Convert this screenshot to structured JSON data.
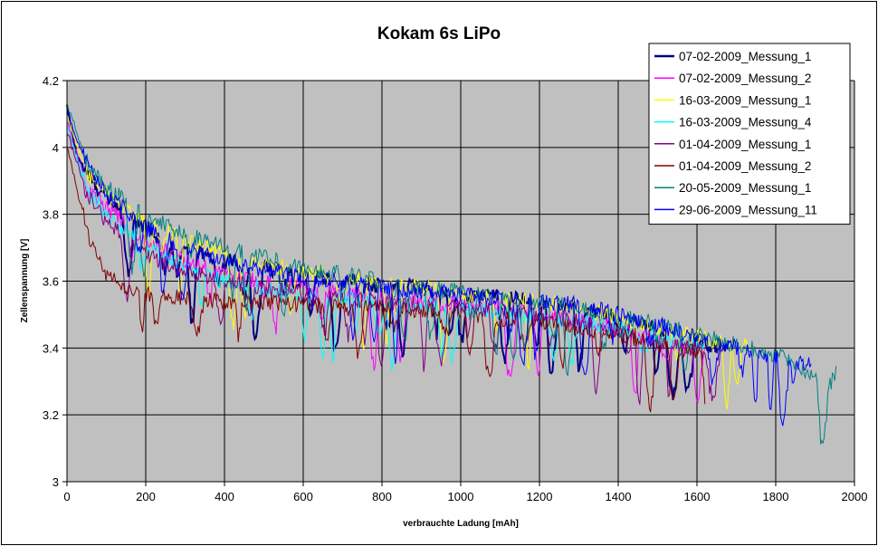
{
  "chart_data": {
    "type": "line",
    "title": "Kokam 6s LiPo",
    "xlabel": "verbrauchte Ladung [mAh]",
    "ylabel": "Zellenspannung [V]",
    "xlim": [
      0,
      2000
    ],
    "ylim": [
      3,
      4.2
    ],
    "x_ticks": [
      "0",
      "200",
      "400",
      "600",
      "800",
      "1000",
      "1200",
      "1400",
      "1600",
      "1800",
      "2000"
    ],
    "y_ticks": [
      "3",
      "3.2",
      "3.4",
      "3.6",
      "3.8",
      "4",
      "4.2"
    ],
    "grid": true,
    "plot_background": "#c0c0c0",
    "legend_position": "top-right",
    "series": [
      {
        "name": "07-02-2009_Messung_1",
        "color": "#000080",
        "end_x": 1680,
        "points": [
          [
            0,
            4.12
          ],
          [
            25,
            3.98
          ],
          [
            50,
            3.92
          ],
          [
            100,
            3.85
          ],
          [
            150,
            3.8
          ],
          [
            200,
            3.76
          ],
          [
            250,
            3.72
          ],
          [
            300,
            3.69
          ],
          [
            400,
            3.66
          ],
          [
            500,
            3.64
          ],
          [
            600,
            3.62
          ],
          [
            700,
            3.6
          ],
          [
            800,
            3.59
          ],
          [
            900,
            3.58
          ],
          [
            1000,
            3.56
          ],
          [
            1100,
            3.55
          ],
          [
            1200,
            3.54
          ],
          [
            1300,
            3.52
          ],
          [
            1400,
            3.49
          ],
          [
            1500,
            3.45
          ],
          [
            1600,
            3.42
          ],
          [
            1680,
            3.4
          ]
        ]
      },
      {
        "name": "07-02-2009_Messung_2",
        "color": "#ff00ff",
        "end_x": 1620,
        "points": [
          [
            0,
            4.08
          ],
          [
            50,
            3.88
          ],
          [
            100,
            3.82
          ],
          [
            200,
            3.72
          ],
          [
            300,
            3.66
          ],
          [
            400,
            3.62
          ],
          [
            500,
            3.6
          ],
          [
            600,
            3.58
          ],
          [
            700,
            3.56
          ],
          [
            800,
            3.55
          ],
          [
            900,
            3.54
          ],
          [
            1000,
            3.53
          ],
          [
            1100,
            3.52
          ],
          [
            1200,
            3.5
          ],
          [
            1300,
            3.48
          ],
          [
            1400,
            3.46
          ],
          [
            1500,
            3.42
          ],
          [
            1620,
            3.38
          ]
        ]
      },
      {
        "name": "16-03-2009_Messung_1",
        "color": "#ffff00",
        "end_x": 1730,
        "points": [
          [
            0,
            4.1
          ],
          [
            50,
            3.92
          ],
          [
            100,
            3.86
          ],
          [
            200,
            3.78
          ],
          [
            300,
            3.72
          ],
          [
            400,
            3.68
          ],
          [
            500,
            3.65
          ],
          [
            600,
            3.63
          ],
          [
            700,
            3.61
          ],
          [
            800,
            3.59
          ],
          [
            900,
            3.58
          ],
          [
            1000,
            3.56
          ],
          [
            1100,
            3.55
          ],
          [
            1200,
            3.54
          ],
          [
            1300,
            3.52
          ],
          [
            1400,
            3.49
          ],
          [
            1500,
            3.46
          ],
          [
            1600,
            3.43
          ],
          [
            1730,
            3.41
          ]
        ]
      },
      {
        "name": "16-03-2009_Messung_4",
        "color": "#00ffff",
        "end_x": 1620,
        "points": [
          [
            0,
            4.06
          ],
          [
            50,
            3.88
          ],
          [
            100,
            3.8
          ],
          [
            200,
            3.7
          ],
          [
            300,
            3.64
          ],
          [
            400,
            3.6
          ],
          [
            500,
            3.58
          ],
          [
            600,
            3.56
          ],
          [
            700,
            3.55
          ],
          [
            800,
            3.54
          ],
          [
            900,
            3.53
          ],
          [
            1000,
            3.52
          ],
          [
            1100,
            3.51
          ],
          [
            1200,
            3.49
          ],
          [
            1300,
            3.48
          ],
          [
            1400,
            3.46
          ],
          [
            1500,
            3.43
          ],
          [
            1620,
            3.4
          ]
        ]
      },
      {
        "name": "01-04-2009_Messung_1",
        "color": "#800080",
        "end_x": 1660,
        "points": [
          [
            0,
            4.05
          ],
          [
            50,
            3.86
          ],
          [
            100,
            3.78
          ],
          [
            200,
            3.68
          ],
          [
            300,
            3.63
          ],
          [
            400,
            3.6
          ],
          [
            500,
            3.58
          ],
          [
            600,
            3.56
          ],
          [
            700,
            3.55
          ],
          [
            800,
            3.54
          ],
          [
            900,
            3.53
          ],
          [
            1000,
            3.52
          ],
          [
            1100,
            3.51
          ],
          [
            1200,
            3.5
          ],
          [
            1300,
            3.48
          ],
          [
            1400,
            3.45
          ],
          [
            1500,
            3.42
          ],
          [
            1660,
            3.38
          ]
        ]
      },
      {
        "name": "01-04-2009_Messung_2",
        "color": "#800000",
        "end_x": 1620,
        "points": [
          [
            0,
            4.0
          ],
          [
            30,
            3.85
          ],
          [
            60,
            3.72
          ],
          [
            100,
            3.62
          ],
          [
            150,
            3.57
          ],
          [
            200,
            3.56
          ],
          [
            300,
            3.55
          ],
          [
            400,
            3.54
          ],
          [
            500,
            3.54
          ],
          [
            600,
            3.53
          ],
          [
            700,
            3.52
          ],
          [
            800,
            3.52
          ],
          [
            900,
            3.51
          ],
          [
            1000,
            3.5
          ],
          [
            1100,
            3.49
          ],
          [
            1200,
            3.48
          ],
          [
            1300,
            3.46
          ],
          [
            1400,
            3.44
          ],
          [
            1500,
            3.41
          ],
          [
            1620,
            3.38
          ]
        ]
      },
      {
        "name": "20-05-2009_Messung_1",
        "color": "#008080",
        "end_x": 1955,
        "points": [
          [
            0,
            4.13
          ],
          [
            50,
            3.96
          ],
          [
            100,
            3.88
          ],
          [
            200,
            3.8
          ],
          [
            300,
            3.74
          ],
          [
            400,
            3.7
          ],
          [
            500,
            3.67
          ],
          [
            600,
            3.64
          ],
          [
            700,
            3.62
          ],
          [
            800,
            3.6
          ],
          [
            900,
            3.58
          ],
          [
            1000,
            3.57
          ],
          [
            1100,
            3.55
          ],
          [
            1200,
            3.54
          ],
          [
            1300,
            3.52
          ],
          [
            1400,
            3.5
          ],
          [
            1500,
            3.47
          ],
          [
            1600,
            3.44
          ],
          [
            1700,
            3.41
          ],
          [
            1800,
            3.38
          ],
          [
            1850,
            3.35
          ],
          [
            1900,
            3.32
          ],
          [
            1940,
            3.29
          ],
          [
            1955,
            3.34
          ]
        ]
      },
      {
        "name": "29-06-2009_Messung_11",
        "color": "#0000ff",
        "end_x": 1890,
        "points": [
          [
            0,
            4.11
          ],
          [
            50,
            3.95
          ],
          [
            100,
            3.86
          ],
          [
            200,
            3.76
          ],
          [
            300,
            3.7
          ],
          [
            400,
            3.66
          ],
          [
            500,
            3.63
          ],
          [
            600,
            3.61
          ],
          [
            700,
            3.6
          ],
          [
            800,
            3.58
          ],
          [
            900,
            3.57
          ],
          [
            1000,
            3.56
          ],
          [
            1100,
            3.55
          ],
          [
            1200,
            3.54
          ],
          [
            1300,
            3.53
          ],
          [
            1400,
            3.5
          ],
          [
            1500,
            3.47
          ],
          [
            1600,
            3.43
          ],
          [
            1700,
            3.4
          ],
          [
            1800,
            3.37
          ],
          [
            1890,
            3.35
          ]
        ]
      }
    ]
  }
}
